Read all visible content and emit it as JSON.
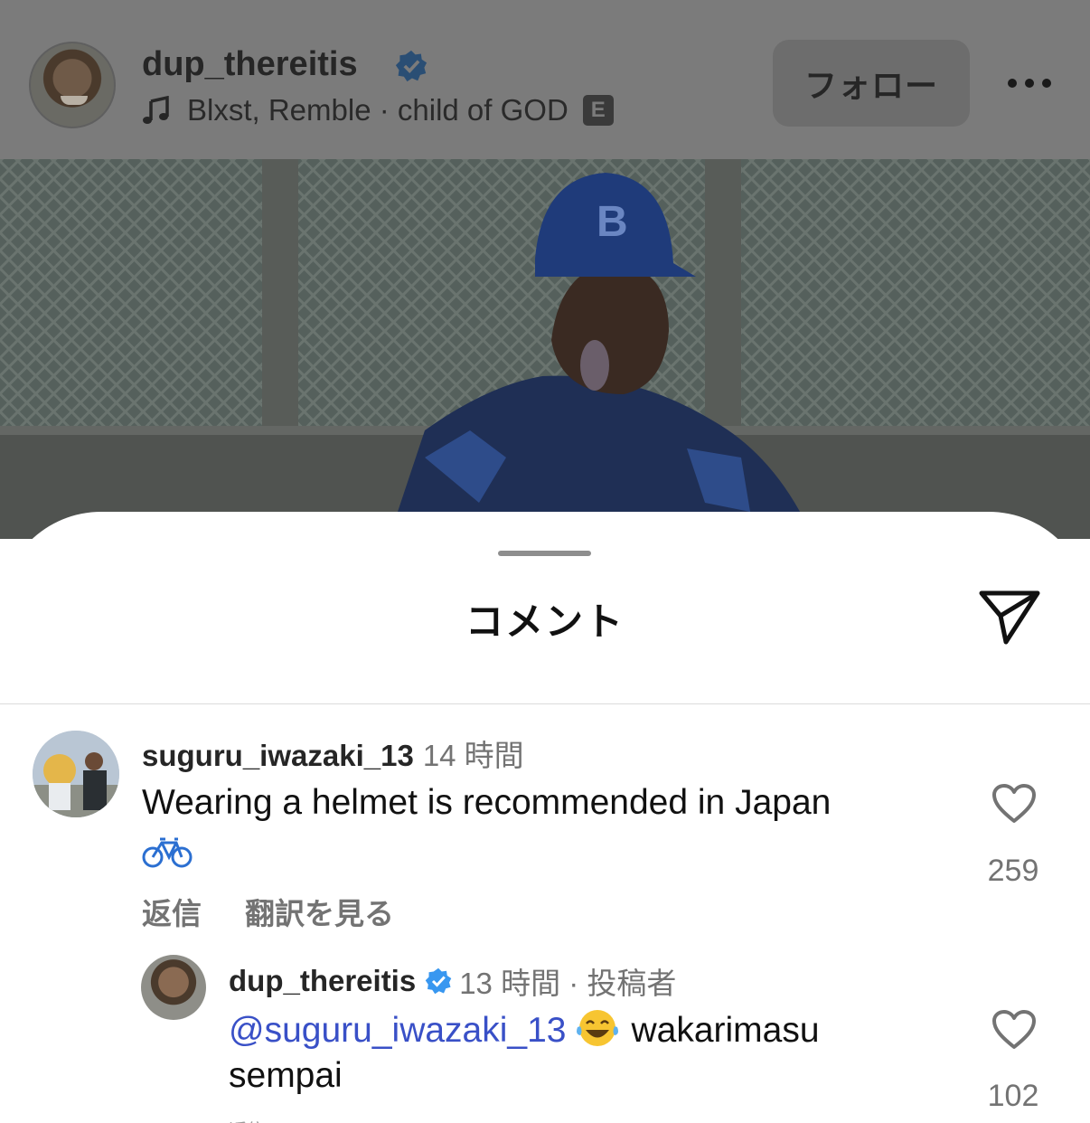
{
  "post": {
    "username": "dup_thereitis",
    "music": "Blxst, Remble · child of GOD",
    "explicit_badge": "E",
    "follow_label": "フォロー"
  },
  "sheet": {
    "title": "コメント"
  },
  "comments": [
    {
      "username": "suguru_iwazaki_13",
      "time": "14 時間",
      "text": "Wearing a helmet is recommended in Japan",
      "likes": "259",
      "reply_label": "返信",
      "translate_label": "翻訳を見る"
    }
  ],
  "reply": {
    "username": "dup_thereitis",
    "time": "13 時間 · 投稿者",
    "mention": "@suguru_iwazaki_13",
    "text_after": "wakarimasu",
    "text_line2": "sempai",
    "likes": "102",
    "reply_label": "返信"
  },
  "colors": {
    "verified": "#3897f0",
    "mention": "#3950c7",
    "dim_overlay": "#7b7b7b"
  }
}
